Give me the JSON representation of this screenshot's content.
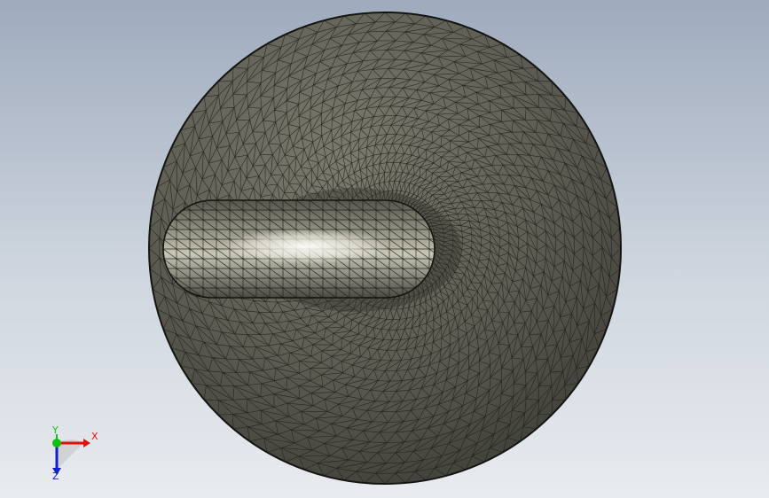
{
  "viewport": {
    "background_top": "#9eabbd",
    "background_bottom": "#e8ebef"
  },
  "model": {
    "shell_color": "#5f5e55",
    "mesh_line_color": "#1c1c18",
    "highlight_color": "#ffffff"
  },
  "triad": {
    "x_label": "X",
    "y_label": "Y",
    "z_label": "Z",
    "x_color": "#e01010",
    "y_color": "#10c010",
    "z_color": "#1020d0"
  }
}
